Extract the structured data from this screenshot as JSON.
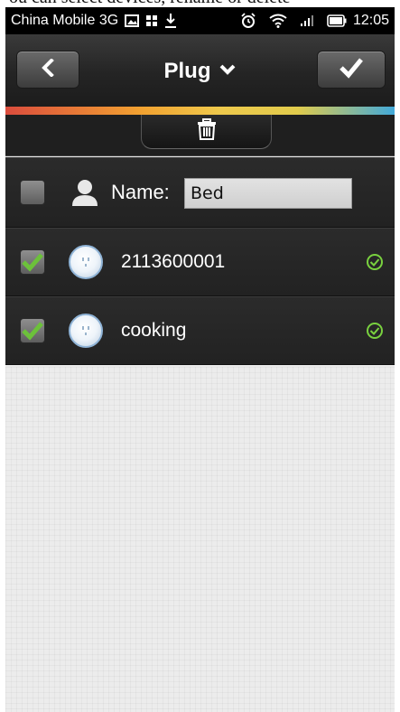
{
  "caption": "ou can select devices, rename or delete",
  "statusbar": {
    "carrier": "China Mobile 3G",
    "time": "12:05"
  },
  "header": {
    "title": "Plug"
  },
  "name_row": {
    "label": "Name:",
    "value": "Bed",
    "checked": false
  },
  "devices": [
    {
      "id_label": "2113600001",
      "checked": true,
      "online": true
    },
    {
      "id_label": "cooking",
      "checked": true,
      "online": true
    }
  ],
  "colors": {
    "accent_green": "#6cc13a",
    "status_ok": "#79d13f",
    "header_dark": "#242424"
  },
  "icons": {
    "back": "chevron-left-icon",
    "confirm": "checkmark-icon",
    "title_dropdown": "chevron-down-icon",
    "delete": "trash-icon",
    "user": "user-icon",
    "plug": "plug-socket-icon",
    "online": "check-circle-icon"
  }
}
